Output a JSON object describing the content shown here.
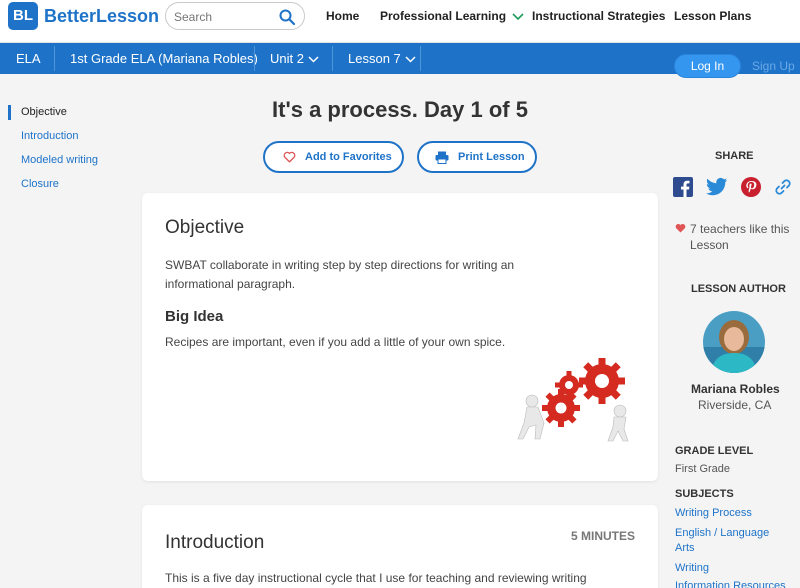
{
  "brand": {
    "logo_letters": "BL",
    "name": "BetterLesson"
  },
  "search": {
    "placeholder": "Search"
  },
  "topnav": {
    "home": "Home",
    "professional_learning": "Professional Learning",
    "instructional_strategies": "Instructional Strategies",
    "lesson_plans": "Lesson Plans"
  },
  "breadcrumb": {
    "subject": "ELA",
    "course": "1st Grade ELA (Mariana Robles)",
    "unit": "Unit 2",
    "lesson": "Lesson 7"
  },
  "auth": {
    "login": "Log In",
    "signup": "Sign Up"
  },
  "sidebar": {
    "items": [
      "Objective",
      "Introduction",
      "Modeled writing",
      "Closure"
    ],
    "active_index": 0
  },
  "lesson": {
    "title": "It's a process. Day 1 of 5",
    "add_favorites": "Add to Favorites",
    "print": "Print Lesson"
  },
  "objective_card": {
    "heading": "Objective",
    "text": "SWBAT collaborate in writing step by step directions for writing an informational paragraph.",
    "big_idea_heading": "Big Idea",
    "big_idea_text": "Recipes are important, even if you add a little of your own spice."
  },
  "intro_card": {
    "heading": "Introduction",
    "minutes": "5 MINUTES",
    "text": "This is a five day instructional cycle that I use for teaching and reviewing writing"
  },
  "share": {
    "heading": "SHARE",
    "icons": [
      "facebook-icon",
      "twitter-icon",
      "pinterest-icon",
      "link-icon"
    ]
  },
  "likes": {
    "text": "7 teachers like this Lesson"
  },
  "author": {
    "heading": "LESSON AUTHOR",
    "name": "Mariana Robles",
    "location": "Riverside, CA"
  },
  "grade": {
    "heading": "GRADE LEVEL",
    "value": "First Grade"
  },
  "subjects": {
    "heading": "SUBJECTS",
    "items": [
      "Writing Process",
      "English / Language Arts",
      "Writing",
      "Information Resources"
    ]
  },
  "colors": {
    "brand_blue": "#1e73c9",
    "login_blue": "#3596f0",
    "heart_red": "#e05555"
  }
}
